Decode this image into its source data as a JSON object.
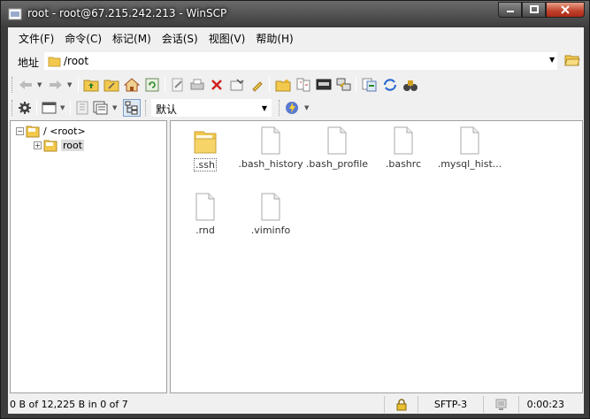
{
  "window": {
    "title": "root - root@67.215.242.213 - WinSCP",
    "controls": {
      "minimize": "minimize",
      "maximize": "maximize",
      "close": "close"
    }
  },
  "menu": {
    "items": [
      "文件(F)",
      "命令(C)",
      "标记(M)",
      "会话(S)",
      "视图(V)",
      "帮助(H)"
    ]
  },
  "address": {
    "label": "地址",
    "path": "/root"
  },
  "toolbar2": {
    "profile_value": "默认"
  },
  "tree": {
    "root_label": "/ <root>",
    "child_label": "root"
  },
  "files": [
    {
      "name": ".ssh",
      "type": "folder"
    },
    {
      "name": ".bash_history",
      "type": "file"
    },
    {
      "name": ".bash_profile",
      "type": "file"
    },
    {
      "name": ".bashrc",
      "type": "file"
    },
    {
      "name": ".mysql_hist...",
      "type": "file"
    },
    {
      "name": ".rnd",
      "type": "file"
    },
    {
      "name": ".viminfo",
      "type": "file"
    }
  ],
  "status": {
    "selection": "0 B of 12,225 B in 0 of 7",
    "protocol": "SFTP-3",
    "elapsed": "0:00:23"
  },
  "colors": {
    "folder_yellow": "#f2c94c",
    "titlebar": "#3c3c3c",
    "client_bg": "#f0f0f0"
  }
}
